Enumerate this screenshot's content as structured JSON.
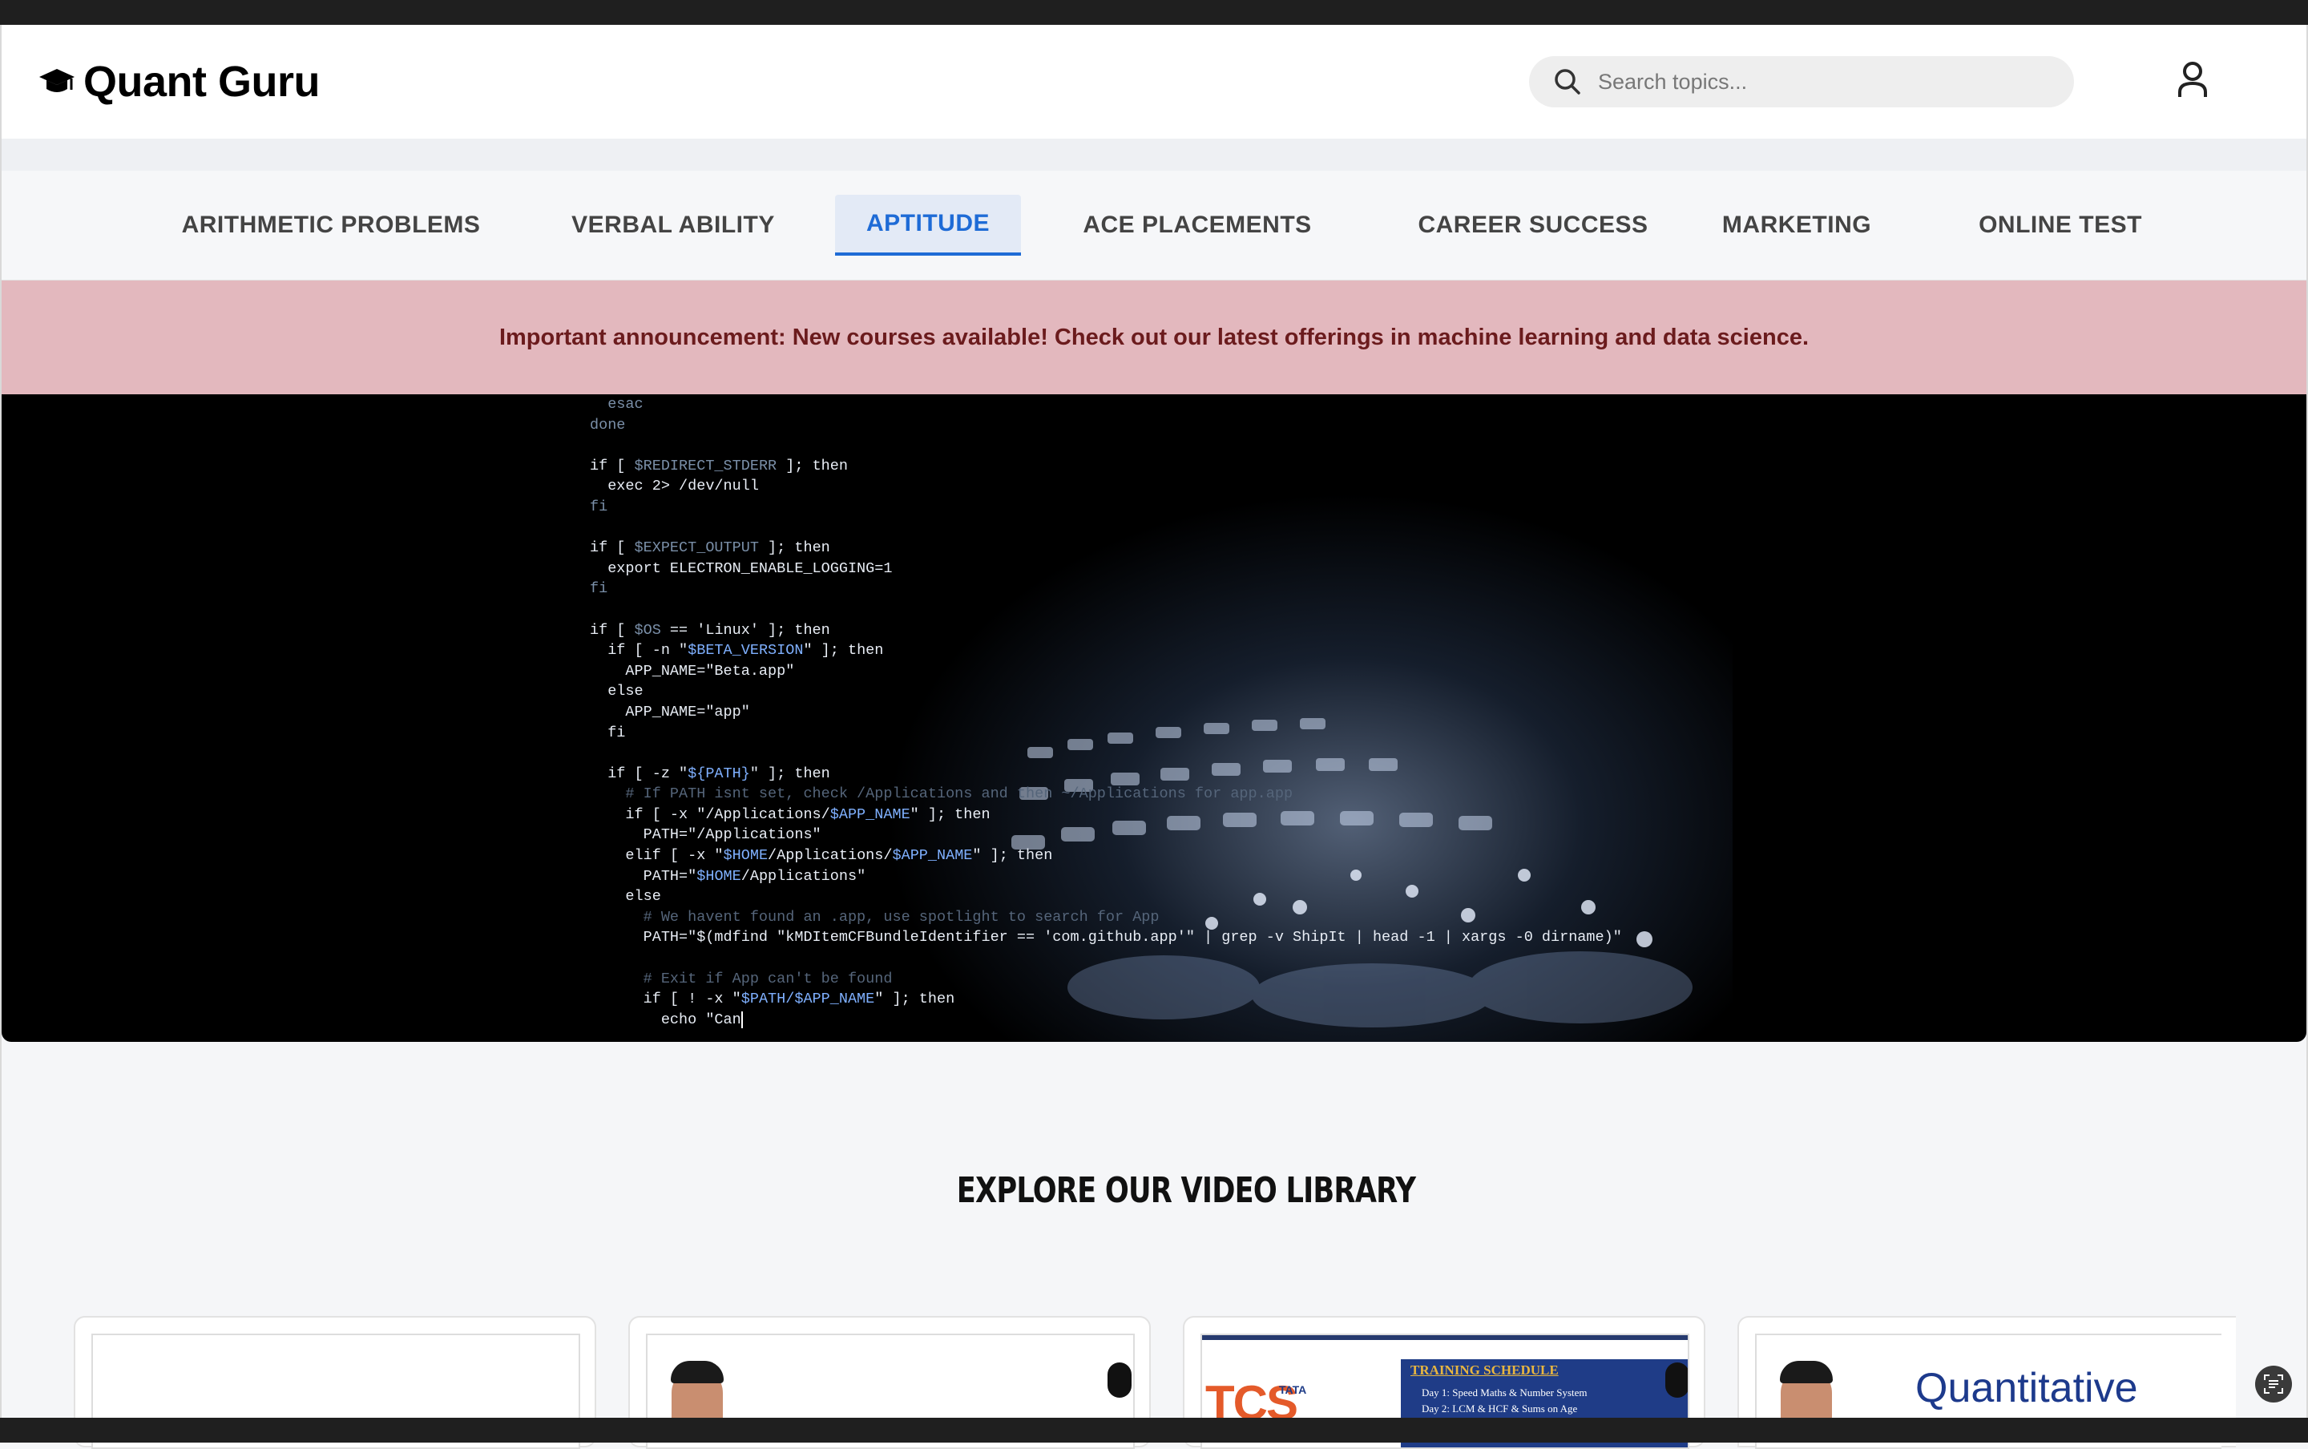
{
  "site": {
    "name": "Quant Guru",
    "logo_icon": "graduation-cap-icon"
  },
  "search": {
    "placeholder": "Search topics...",
    "icon": "search-icon"
  },
  "account": {
    "icon": "user-icon"
  },
  "nav": {
    "tabs": [
      {
        "label": "ARITHMETIC PROBLEMS",
        "active": false
      },
      {
        "label": "VERBAL ABILITY",
        "active": false
      },
      {
        "label": "APTITUDE",
        "active": true
      },
      {
        "label": "ACE PLACEMENTS",
        "active": false
      },
      {
        "label": "CAREER SUCCESS",
        "active": false
      },
      {
        "label": "MARKETING",
        "active": false
      },
      {
        "label": "ONLINE TEST",
        "active": false
      }
    ]
  },
  "announcement": {
    "text": "Important announcement: New courses available! Check out our latest offerings in machine learning and data science."
  },
  "hero": {
    "code_lines": [
      "  esac",
      "done",
      "",
      "if [ $REDIRECT_STDERR ]; then",
      "  exec 2> /dev/null",
      "fi",
      "",
      "if [ $EXPECT_OUTPUT ]; then",
      "  export ELECTRON_ENABLE_LOGGING=1",
      "fi",
      "",
      "if [ $OS == 'Linux' ]; then",
      "  if [ -n \"$BETA_VERSION\" ]; then",
      "    APP_NAME=\"Beta.app\"",
      "  else",
      "    APP_NAME=\"app\"",
      "  fi",
      "",
      "  if [ -z \"${PATH}\" ]; then",
      "    # If PATH isnt set, check /Applications and then ~/Applications for app.app",
      "    if [ -x \"/Applications/$APP_NAME\" ]; then",
      "      PATH=\"/Applications\"",
      "    elif [ -x \"$HOME/Applications/$APP_NAME\" ]; then",
      "      PATH=\"$HOME/Applications\"",
      "    else",
      "      # We havent found an .app, use spotlight to search for App",
      "      PATH=\"$(mdfind \"kMDItemCFBundleIdentifier == 'com.github.app'\" | grep -v ShipIt | head -1 | xargs -0 dirname)\"",
      "",
      "      # Exit if App can't be found",
      "      if [ ! -x \"$PATH/$APP_NAME\" ]; then",
      "        echo \"Can"
    ]
  },
  "video_library": {
    "title": "EXPLORE OUR VIDEO LIBRARY",
    "cards": [
      {
        "thumbnail": "blank"
      },
      {
        "thumbnail": "presenter"
      },
      {
        "thumbnail": "training-schedule",
        "schedule_title": "TRAINING SCHEDULE",
        "schedule_lines": [
          "Day 1: Speed Maths & Number System",
          "Day 2: LCM & HCF & Sums on Age"
        ],
        "brand_text": "TCS",
        "brand_sub": "TATA"
      },
      {
        "thumbnail": "quantitative",
        "heading": "Quantitative"
      }
    ]
  },
  "colors": {
    "accent": "#1e6bd6",
    "announcement_bg": "#e3b8be",
    "announcement_text": "#6b1b1d"
  }
}
